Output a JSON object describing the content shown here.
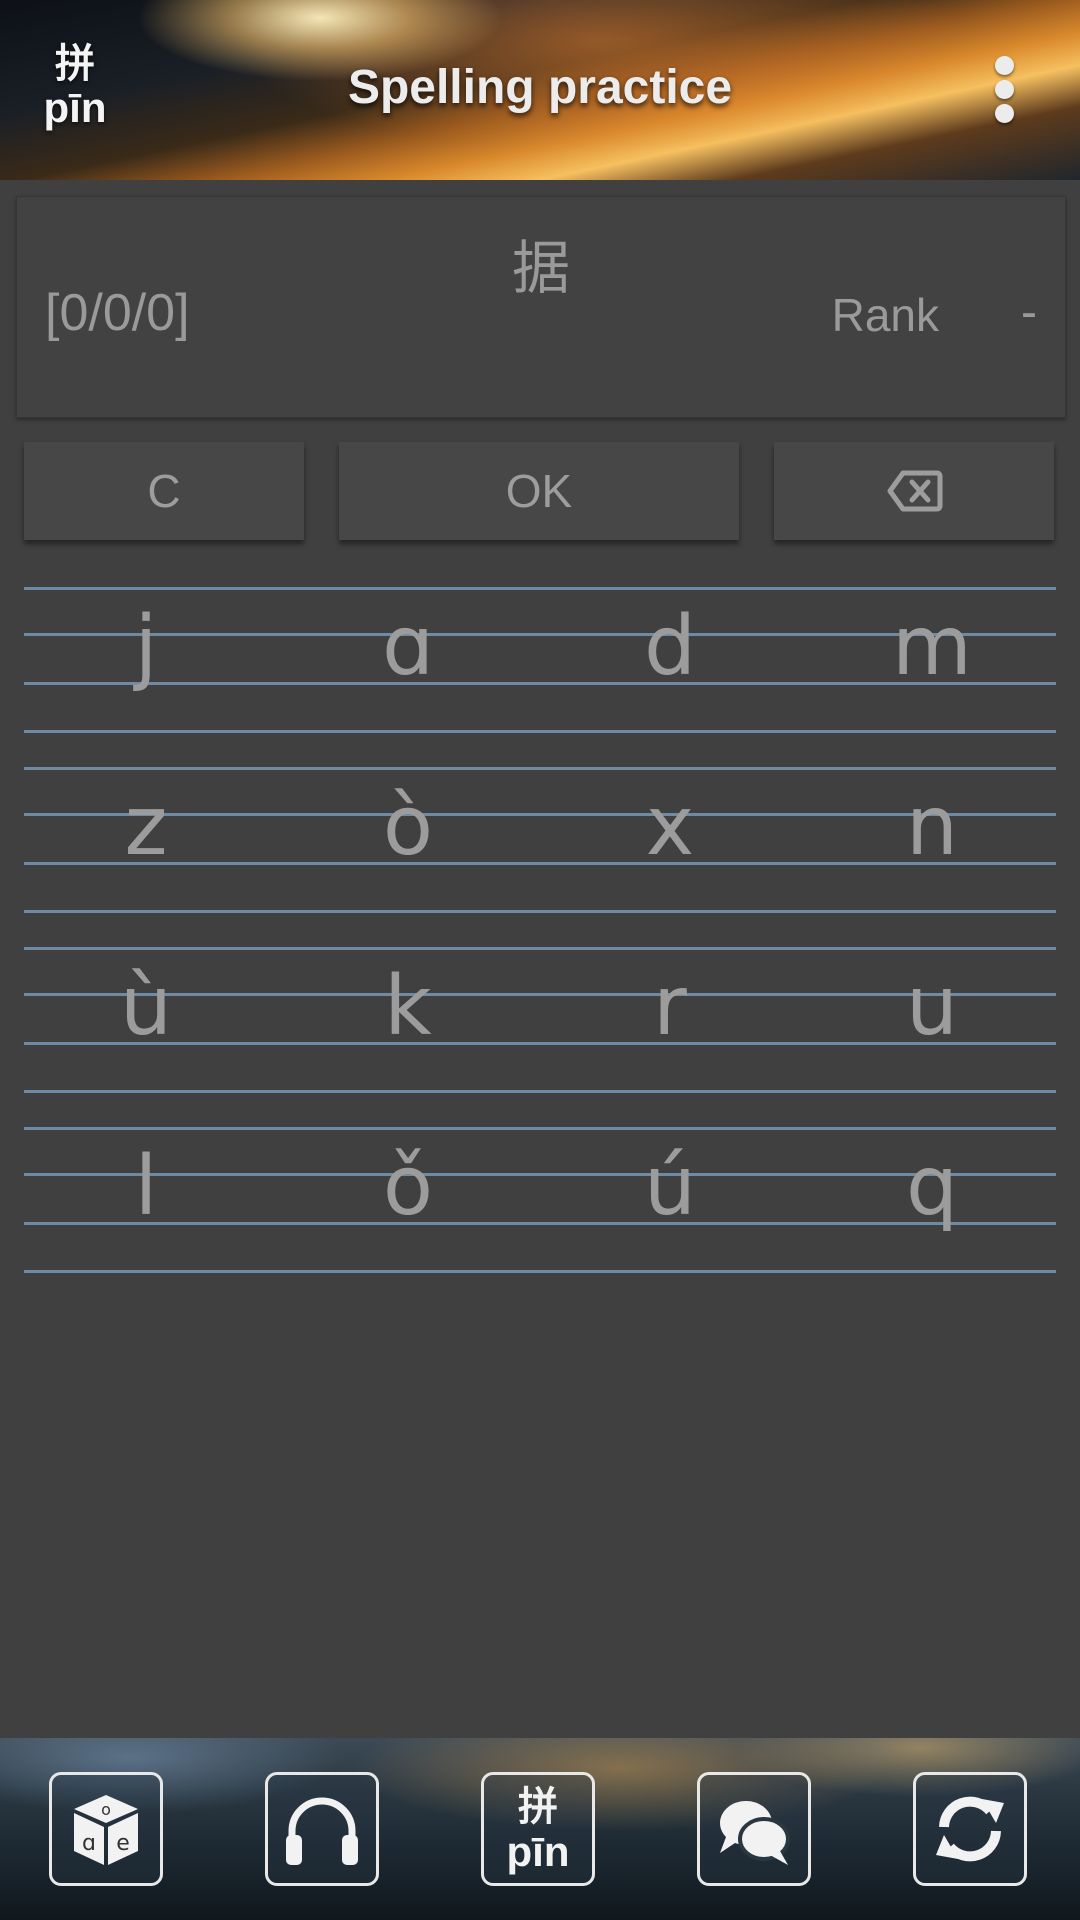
{
  "header": {
    "logo_han": "拼",
    "logo_pinyin": "pīn",
    "title": "Spelling practice",
    "menu_icon": "more-vert-icon"
  },
  "card": {
    "hanzi": "据",
    "score": "[0/0/0]",
    "rank_label": "Rank",
    "rank_value": "-"
  },
  "actions": {
    "clear_label": "C",
    "ok_label": "OK",
    "backspace_icon": "backspace-icon"
  },
  "keyboard": {
    "rows": [
      [
        "j",
        "ɑ",
        "d",
        "m"
      ],
      [
        "z",
        "ò",
        "x",
        "n"
      ],
      [
        "ù",
        "k",
        "r",
        "u"
      ],
      [
        "l",
        "ǒ",
        "ú",
        "q"
      ]
    ]
  },
  "bottom_nav": {
    "items": [
      {
        "icon": "dice-vowels-icon"
      },
      {
        "icon": "headphones-icon"
      },
      {
        "icon": "pinyin-icon",
        "han": "拼",
        "pinyin": "pīn"
      },
      {
        "icon": "chat-bubbles-icon"
      },
      {
        "icon": "refresh-icon"
      }
    ],
    "dice_faces": [
      "o",
      "ɑ",
      "e"
    ]
  },
  "colors": {
    "background": "#404040",
    "line": "#6f8aa3",
    "text_muted": "#9c9c9c"
  }
}
